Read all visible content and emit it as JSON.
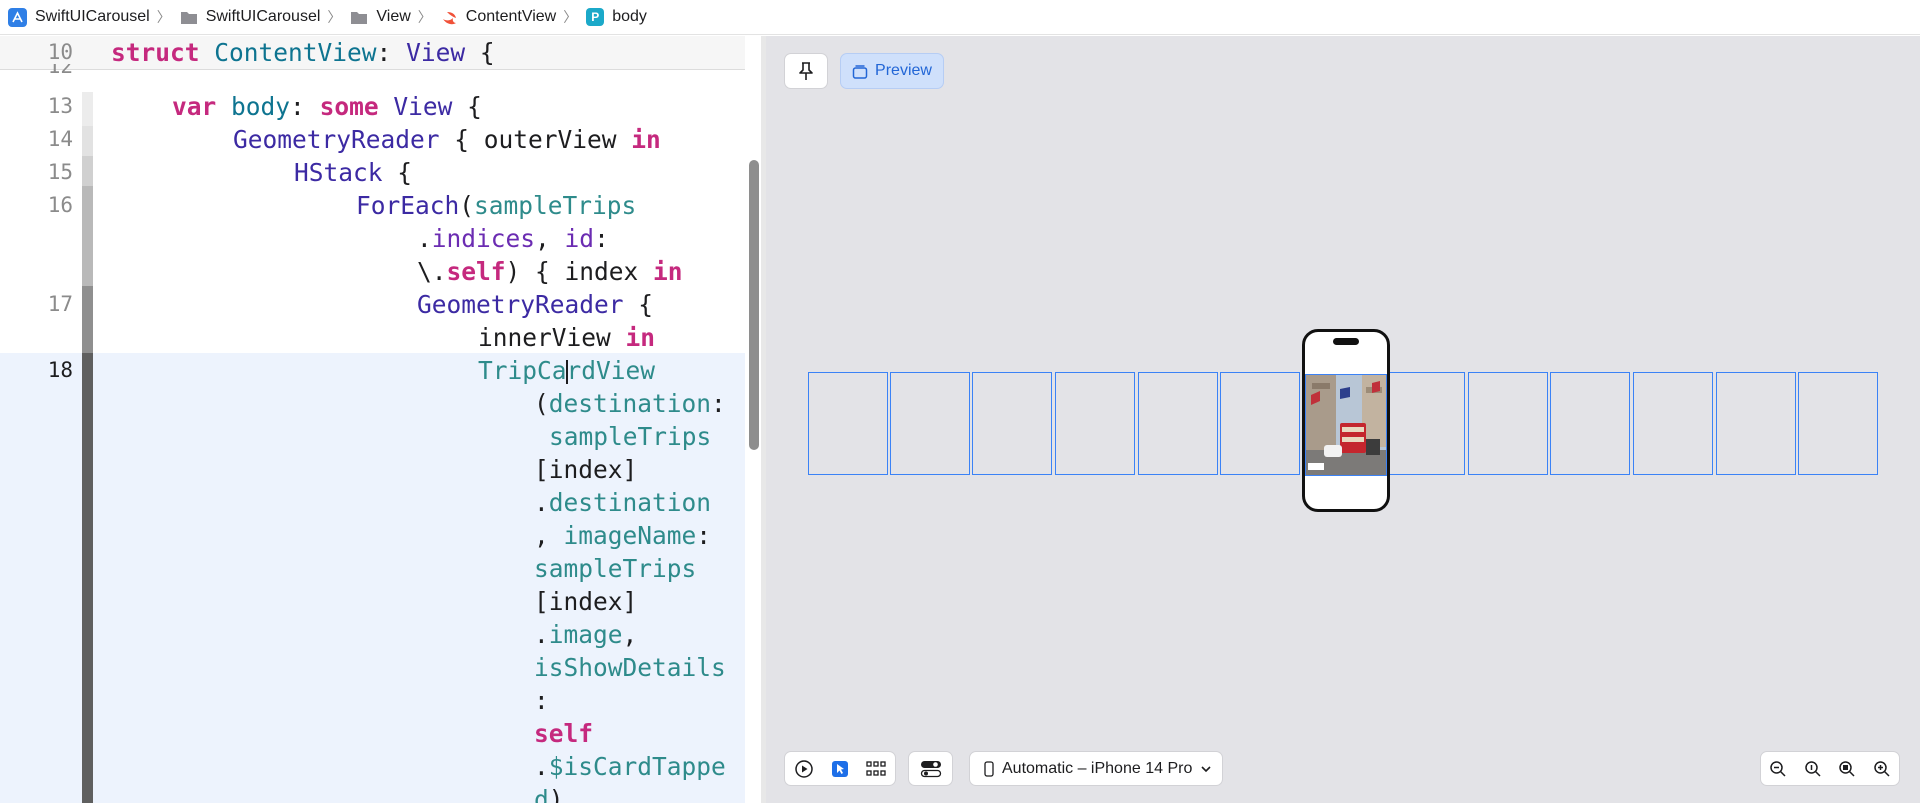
{
  "breadcrumb": {
    "items": [
      {
        "label": "SwiftUICarousel",
        "icon": "xcode-project-icon"
      },
      {
        "label": "SwiftUICarousel",
        "icon": "folder-icon"
      },
      {
        "label": "View",
        "icon": "folder-icon"
      },
      {
        "label": "ContentView",
        "icon": "swift-file-icon"
      },
      {
        "label": "body",
        "icon": "property-icon"
      }
    ],
    "property_glyph": "P"
  },
  "editor": {
    "sticky": {
      "line": "10",
      "partial_line": "12"
    },
    "lines": [
      "13",
      "14",
      "15",
      "16",
      "17",
      "18"
    ],
    "current_line": "18"
  },
  "preview": {
    "pin_label": "pin",
    "preview_label": "Preview",
    "device_label": "Automatic – iPhone 14 Pro",
    "accent": "#2266d6"
  },
  "colors": {
    "keyword": "#c5297e",
    "type": "#3c2aa3",
    "member": "#2e8b8b",
    "selection": "#edf3fd",
    "card_outline": "#3b82f6"
  }
}
